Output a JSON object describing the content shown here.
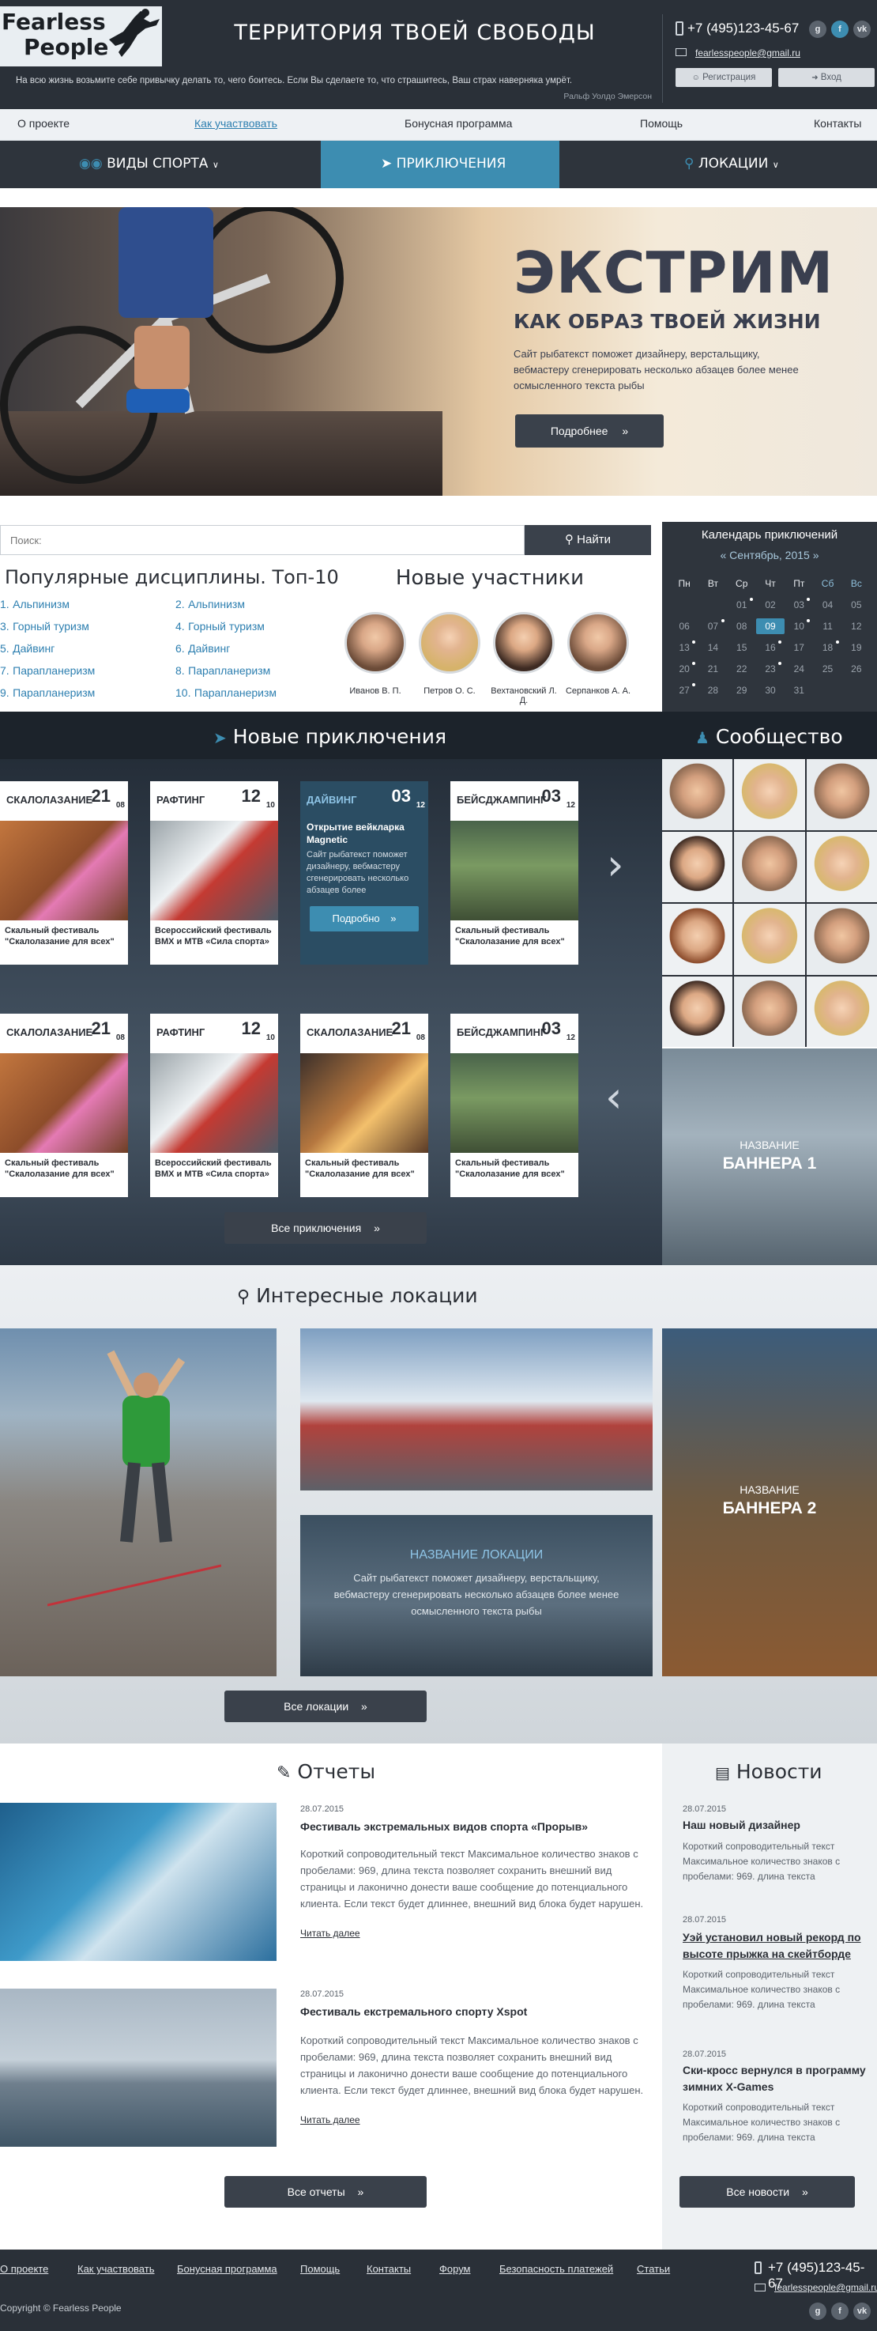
{
  "header": {
    "logo_line1": "Fearless",
    "logo_line2": "People",
    "slogan": "ТЕРРИТОРИЯ ТВОЕЙ СВОБОДЫ",
    "quote": "На всю жизнь возьмите себе привычку делать то, чего боитесь. Если Вы сделаете то, что страшитесь, Ваш страх наверняка умрёт.",
    "quote_author": "Ральф Уолдо Эмерсон",
    "phone": "+7 (495)123-45-67",
    "email": "fearlesspeople@gmail.ru",
    "social": [
      "g",
      "f",
      "vk"
    ],
    "register_label": "Регистрация",
    "login_label": "Вход"
  },
  "topnav": [
    "О проекте",
    "Как участвовать",
    "Бонусная программа",
    "Помощь",
    "Контакты"
  ],
  "catnav": {
    "sports_label": "ВИДЫ СПОРТА",
    "adventures_label": "ПРИКЛЮЧЕНИЯ",
    "locations_label": "ЛОКАЦИИ"
  },
  "hero": {
    "title": "ЭКСТРИМ",
    "subtitle": "КАК ОБРАЗ ТВОЕЙ ЖИЗНИ",
    "text": "Сайт рыбатекст поможет дизайнеру, верстальщику, вебмастеру сгенерировать несколько абзацев более менее осмысленного текста рыбы",
    "button": "Подробнее"
  },
  "search": {
    "placeholder": "Поиск:",
    "button": "Найти"
  },
  "calendar": {
    "title": "Календарь приключений",
    "month": "Сентябрь, 2015",
    "weekdays": [
      "Пн",
      "Вт",
      "Ср",
      "Чт",
      "Пт",
      "Сб",
      "Вс"
    ],
    "days": [
      "",
      "",
      "01",
      "02",
      "03",
      "04",
      "05",
      "06",
      "07",
      "08",
      "09",
      "10",
      "11",
      "12",
      "13",
      "14",
      "15",
      "16",
      "17",
      "18",
      "19",
      "20",
      "21",
      "22",
      "23",
      "24",
      "25",
      "26",
      "27",
      "28",
      "29",
      "30",
      "31",
      "",
      "",
      ""
    ],
    "today": "09"
  },
  "popular": {
    "title": "Популярные дисциплины. Топ-10",
    "left": [
      {
        "n": "1.",
        "name": "Альпинизм"
      },
      {
        "n": "3.",
        "name": "Горный туризм"
      },
      {
        "n": "5.",
        "name": "Дайвинг"
      },
      {
        "n": "7.",
        "name": "Парапланеризм"
      },
      {
        "n": "9.",
        "name": "Парапланеризм"
      }
    ],
    "right": [
      {
        "n": "2.",
        "name": "Альпинизм"
      },
      {
        "n": "4.",
        "name": "Горный туризм"
      },
      {
        "n": "6.",
        "name": "Дайвинг"
      },
      {
        "n": "8.",
        "name": "Парапланеризм"
      },
      {
        "n": "10.",
        "name": "Парапланеризм"
      }
    ]
  },
  "new_members": {
    "title": "Новые участники",
    "names": [
      "Иванов В. П.",
      "Петров О. С.",
      "Вехтановский Л. Д.",
      "Серпанков А. А."
    ]
  },
  "adventures": {
    "title": "Новые приключения",
    "row1": [
      {
        "cat": "СКАЛОЛАЗАНИЕ",
        "day": "21",
        "mon": "08",
        "text": "Скальный фестиваль \"Скалолазание для всех\""
      },
      {
        "cat": "РАФТИНГ",
        "day": "12",
        "mon": "10",
        "text": "Всероссийский фестиваль BMX и MTB «Сила спорта»"
      },
      {
        "cat": "ДАЙВИНГ",
        "day": "03",
        "mon": "12",
        "title": "Открытие вейкларка Magnetic",
        "desc": "Сайт рыбатекст поможет дизайнеру, вебмастеру сгенерировать несколько абзацев более",
        "more": "Подробно"
      },
      {
        "cat": "БЕЙСДЖАМПИНГ",
        "day": "03",
        "mon": "12",
        "text": "Скальный фестиваль \"Скалолазание для всех\""
      }
    ],
    "row2": [
      {
        "cat": "СКАЛОЛАЗАНИЕ",
        "day": "21",
        "mon": "08",
        "text": "Скальный фестиваль \"Скалолазание для всех\""
      },
      {
        "cat": "РАФТИНГ",
        "day": "12",
        "mon": "10",
        "text": "Всероссийский фестиваль BMX и MTB «Сила спорта»"
      },
      {
        "cat": "СКАЛОЛАЗАНИЕ",
        "day": "21",
        "mon": "08",
        "text": "Скальный фестиваль \"Скалолазание для всех\""
      },
      {
        "cat": "БЕЙСДЖАМПИНГ",
        "day": "03",
        "mon": "12",
        "text": "Скальный фестиваль \"Скалолазание для всех\""
      }
    ],
    "all_button": "Все приключения"
  },
  "community": {
    "title": "Сообщество",
    "banner_label": "НАЗВАНИЕ",
    "banner_name": "БАННЕРА 1"
  },
  "locations": {
    "title": "Интересные локации",
    "location_title": "НАЗВАНИЕ ЛОКАЦИИ",
    "location_text": "Сайт рыбатекст поможет дизайнеру, верстальщику, вебмастеру сгенерировать несколько абзацев более менее осмысленного текста рыбы",
    "banner_label": "НАЗВАНИЕ",
    "banner_name": "БАННЕРА 2",
    "all_button": "Все локации"
  },
  "reports": {
    "title": "Отчеты",
    "items": [
      {
        "date": "28.07.2015",
        "title": "Фестиваль экстремальных видов спорта «Прорыв»",
        "text": "Короткий сопроводительный текст Максимальное количество знаков с пробелами: 969, длина текста позволяет сохранить внешний вид страницы и лаконично донести ваше сообщение до потенциального клиента. Если текст будет длиннее, внешний вид блока будет нарушен.",
        "more": "Читать далее"
      },
      {
        "date": "28.07.2015",
        "title": "Фестиваль екстремального спорту Xspot",
        "text": "Короткий сопроводительный текст Максимальное количество знаков с пробелами: 969, длина текста позволяет сохранить внешний вид страницы и лаконично донести ваше сообщение до потенциального клиента. Если текст будет длиннее, внешний вид блока будет нарушен.",
        "more": "Читать далее"
      }
    ],
    "all_button": "Все отчеты"
  },
  "news": {
    "title": "Новости",
    "items": [
      {
        "date": "28.07.2015",
        "title": "Наш новый дизайнер",
        "text": "Короткий сопроводительный текст Максимальное количество знаков с пробелами: 969. длина текста"
      },
      {
        "date": "28.07.2015",
        "title": "Уэй установил новый рекорд по высоте прыжка на скейтборде",
        "text": "Короткий сопроводительный текст Максимальное количество знаков с пробелами: 969. длина текста"
      },
      {
        "date": "28.07.2015",
        "title": "Ски-кросс вернулся в программу зимних X-Games",
        "text": "Короткий сопроводительный текст Максимальное количество знаков с пробелами: 969. длина текста"
      }
    ],
    "all_button": "Все новости"
  },
  "footer": {
    "links": [
      "О проекте",
      "Как участвовать",
      "Бонусная программа",
      "Помощь",
      "Контакты",
      "Форум",
      "Безопасность платежей",
      "Статьи"
    ],
    "copyright": "Copyright © Fearless People",
    "phone": "+7 (495)123-45-67",
    "email": "fearlesspeople@gmail.ru",
    "social": [
      "g",
      "f",
      "vk"
    ]
  },
  "colors": {
    "header_bg": "#2a3038",
    "accent": "#3d8db1",
    "link": "#2d7fb0",
    "button_dark": "#3a414b"
  }
}
